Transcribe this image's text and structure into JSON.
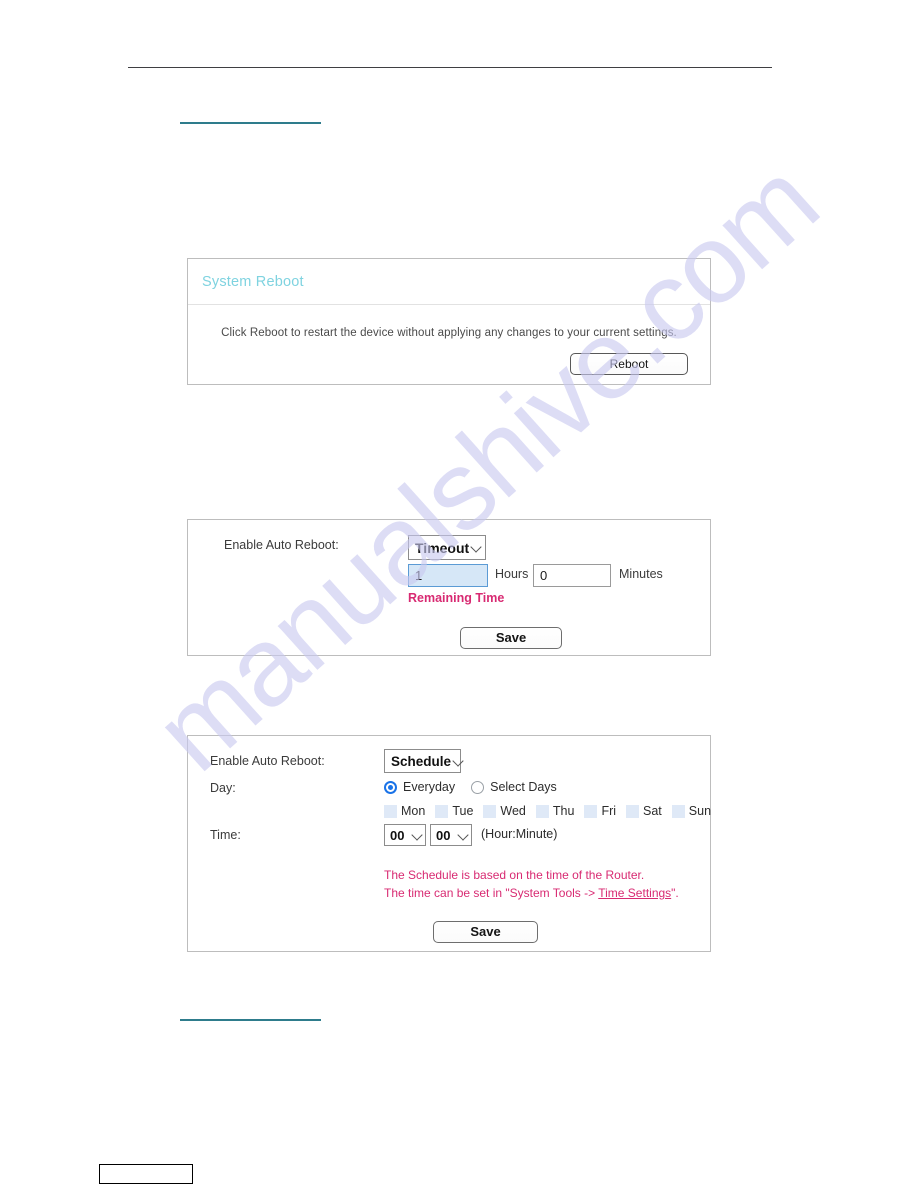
{
  "page": {
    "footer_box_text": ""
  },
  "links": {
    "top_link_text": "",
    "bottom_link_text": ""
  },
  "watermark": {
    "text": "manualshive.com"
  },
  "reboot_panel": {
    "title": "System Reboot",
    "description": "Click Reboot to restart the device without applying any changes to your current settings.",
    "reboot_button": "Reboot"
  },
  "timeout_panel": {
    "enable_label": "Enable Auto Reboot:",
    "mode_value": "Timeout",
    "hours_value": "1",
    "hours_unit": "Hours",
    "minutes_value": "0",
    "minutes_unit": "Minutes",
    "remaining_time": "Remaining Time",
    "save_button": "Save"
  },
  "schedule_panel": {
    "enable_label": "Enable Auto Reboot:",
    "mode_value": "Schedule",
    "day_label": "Day:",
    "radio_everyday": "Everyday",
    "radio_select_days": "Select Days",
    "days": [
      "Mon",
      "Tue",
      "Wed",
      "Thu",
      "Fri",
      "Sat",
      "Sun"
    ],
    "time_label": "Time:",
    "hour_value": "00",
    "minute_value": "00",
    "hour_minute_hint": "(Hour:Minute)",
    "note_line_1": "The Schedule is based on the time of the Router.",
    "note_line_2_prefix": "The time can be set in \"System Tools -> ",
    "note_link": "Time Settings",
    "note_line_2_suffix": "\".",
    "save_button": "Save"
  },
  "colors": {
    "panel_title": "#7fd3e0",
    "note_pink": "#d82a72",
    "radio_accent": "#1a73e8",
    "focus_field_bg": "#d6e7f7",
    "link_rule": "#2e7c8c"
  }
}
